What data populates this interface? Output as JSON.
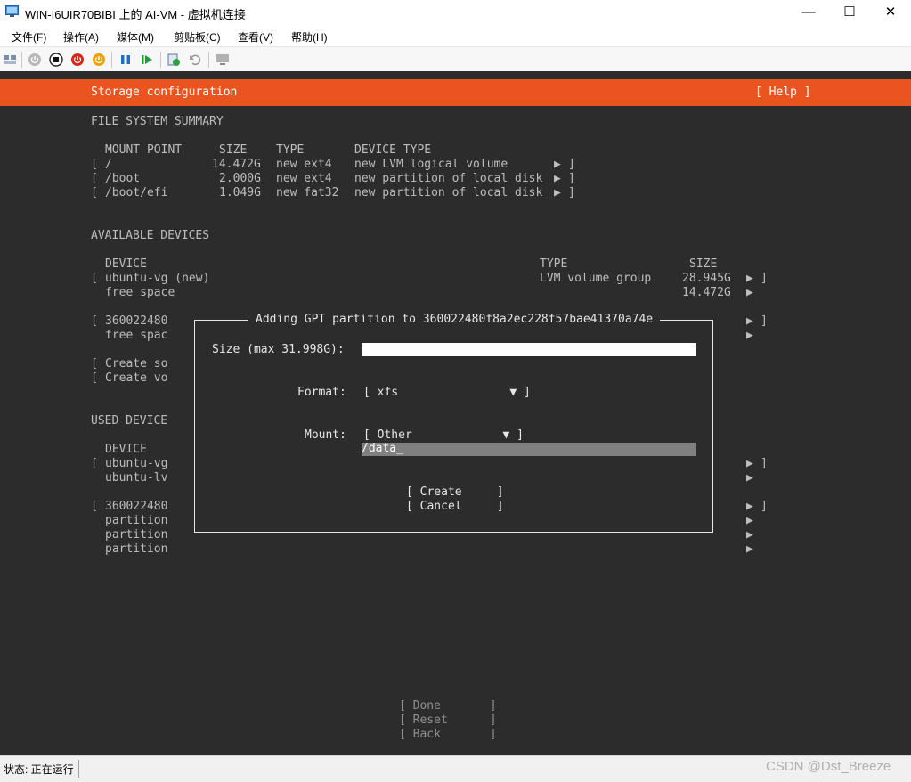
{
  "window": {
    "title": "WIN-I6UIR70BIBI 上的 AI-VM - 虚拟机连接",
    "minimize_glyph": "—",
    "maximize_glyph": "☐",
    "close_glyph": "✕"
  },
  "menu": [
    "文件(F)",
    "操作(A)",
    "媒体(M)",
    "剪贴板(C)",
    "查看(V)",
    "帮助(H)"
  ],
  "toolbar_icons": [
    "ctrl-alt-del-icon",
    "start-icon",
    "turn-off-icon",
    "shutdown-icon",
    "power-icon",
    "pause-icon",
    "resume-icon",
    "checkpoint-icon",
    "revert-icon",
    "enhanced-session-icon"
  ],
  "header": {
    "title": "Storage configuration",
    "help": "[ Help ]"
  },
  "fs_summary": {
    "heading": "FILE SYSTEM SUMMARY",
    "columns": {
      "mount": "MOUNT POINT",
      "size": "SIZE",
      "type": "TYPE",
      "device_type": "DEVICE TYPE"
    },
    "rows": [
      {
        "open": "[",
        "mount": "/",
        "size": "14.472G",
        "type": "new ext4",
        "device_type": "new LVM logical volume",
        "arrow": "▶",
        "close": "]"
      },
      {
        "open": "[",
        "mount": "/boot",
        "size": "2.000G",
        "type": "new ext4",
        "device_type": "new partition of local disk",
        "arrow": "▶",
        "close": "]"
      },
      {
        "open": "[",
        "mount": "/boot/efi",
        "size": "1.049G",
        "type": "new fat32",
        "device_type": "new partition of local disk",
        "arrow": "▶",
        "close": "]"
      }
    ]
  },
  "available": {
    "heading": "AVAILABLE DEVICES",
    "columns": {
      "device": "DEVICE",
      "type": "TYPE",
      "size": "SIZE"
    },
    "vg": {
      "open": "[",
      "device": "ubuntu-vg (new)",
      "type": "LVM volume group",
      "size": "28.945G",
      "arrow": "▶",
      "close": "]"
    },
    "vg_free": {
      "device": "free space",
      "size": "14.472G",
      "arrow": "▶"
    },
    "disk": {
      "open": "[",
      "device": "360022480",
      "arrow": "▶",
      "close": "]"
    },
    "disk_free": {
      "device": "free spac",
      "arrow": "▶"
    },
    "create_so": {
      "open": "[",
      "label": "Create so"
    },
    "create_vo": {
      "open": "[",
      "label": "Create vo"
    }
  },
  "used": {
    "heading": "USED DEVICE",
    "column_device": "DEVICE",
    "vg": {
      "open": "[",
      "device": "ubuntu-vg",
      "arrow": "▶",
      "close": "]"
    },
    "lv": {
      "device": "ubuntu-lv",
      "arrow": "▶"
    },
    "disk": {
      "open": "[",
      "device": "360022480",
      "arrow": "▶",
      "close": "]"
    },
    "partitions": [
      {
        "device": "partition",
        "arrow": "▶"
      },
      {
        "device": "partition",
        "arrow": "▶"
      },
      {
        "device": "partition",
        "arrow": "▶"
      }
    ]
  },
  "dialog": {
    "title": "Adding GPT partition to 360022480f8a2ec228f57bae41370a74e",
    "size_label": "Size (max 31.998G):",
    "size_value": "",
    "format_label": "Format:",
    "format_value": "[ xfs                ▼ ]",
    "mount_label": "Mount:",
    "mount_value": "[ Other             ▼ ]",
    "mount_path_value": "/data_",
    "create_button": "[ Create     ]",
    "cancel_button": "[ Cancel     ]"
  },
  "footer_buttons": {
    "done": "[ Done       ]",
    "reset": "[ Reset      ]",
    "back": "[ Back       ]"
  },
  "status": {
    "text": "状态: 正在运行"
  },
  "watermark": "CSDN @Dst_Breeze"
}
